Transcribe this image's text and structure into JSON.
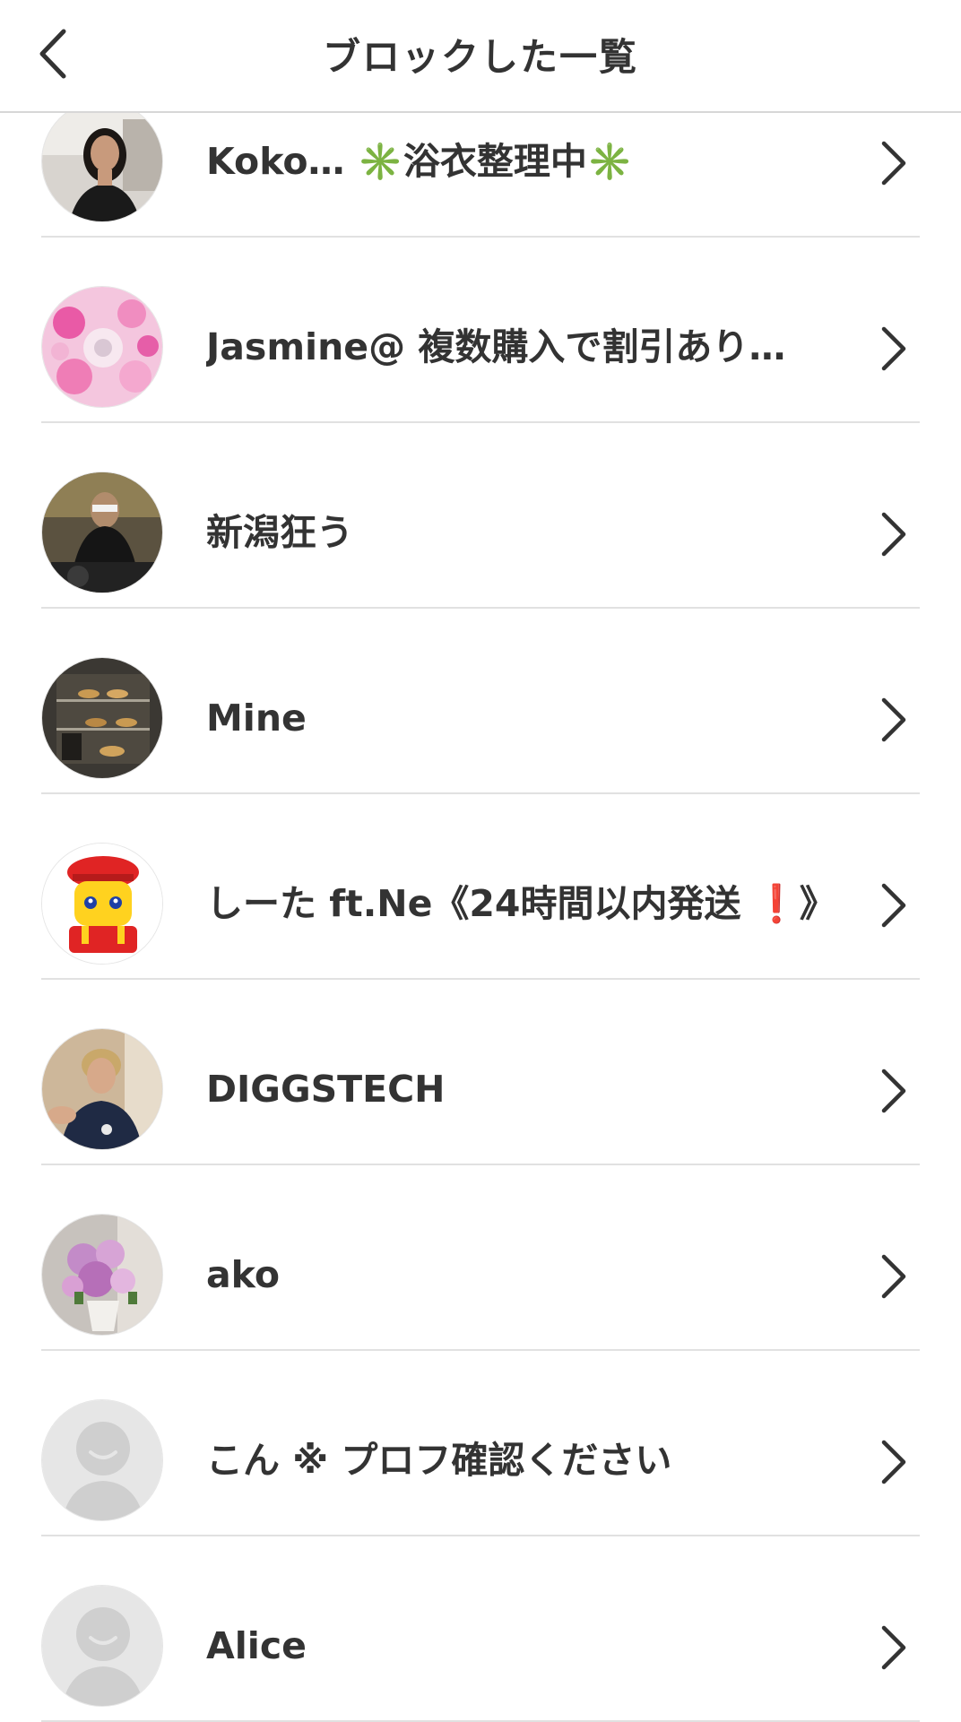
{
  "header": {
    "title": "ブロックした一覧",
    "back_icon": "chevron-left-icon"
  },
  "blocked_users": [
    {
      "name": "Koko… ✳️浴衣整理中✳️",
      "avatar": "photo-woman"
    },
    {
      "name": "Jasmine@ 複数購入で割引あり…",
      "avatar": "photo-pink-flowers"
    },
    {
      "name": "新潟狂う",
      "avatar": "photo-dj"
    },
    {
      "name": "Mine",
      "avatar": "photo-bakery-case"
    },
    {
      "name": "しーた ft.Ne《24時間以内発送 ❗️》",
      "avatar": "cartoon-character"
    },
    {
      "name": "DIGGSTECH",
      "avatar": "photo-man"
    },
    {
      "name": "ako",
      "avatar": "photo-flower-bouquet"
    },
    {
      "name": "こん ※ プロフ確認ください",
      "avatar": "default-avatar"
    },
    {
      "name": "Alice",
      "avatar": "default-avatar"
    }
  ],
  "row_action_icon": "chevron-right-icon"
}
